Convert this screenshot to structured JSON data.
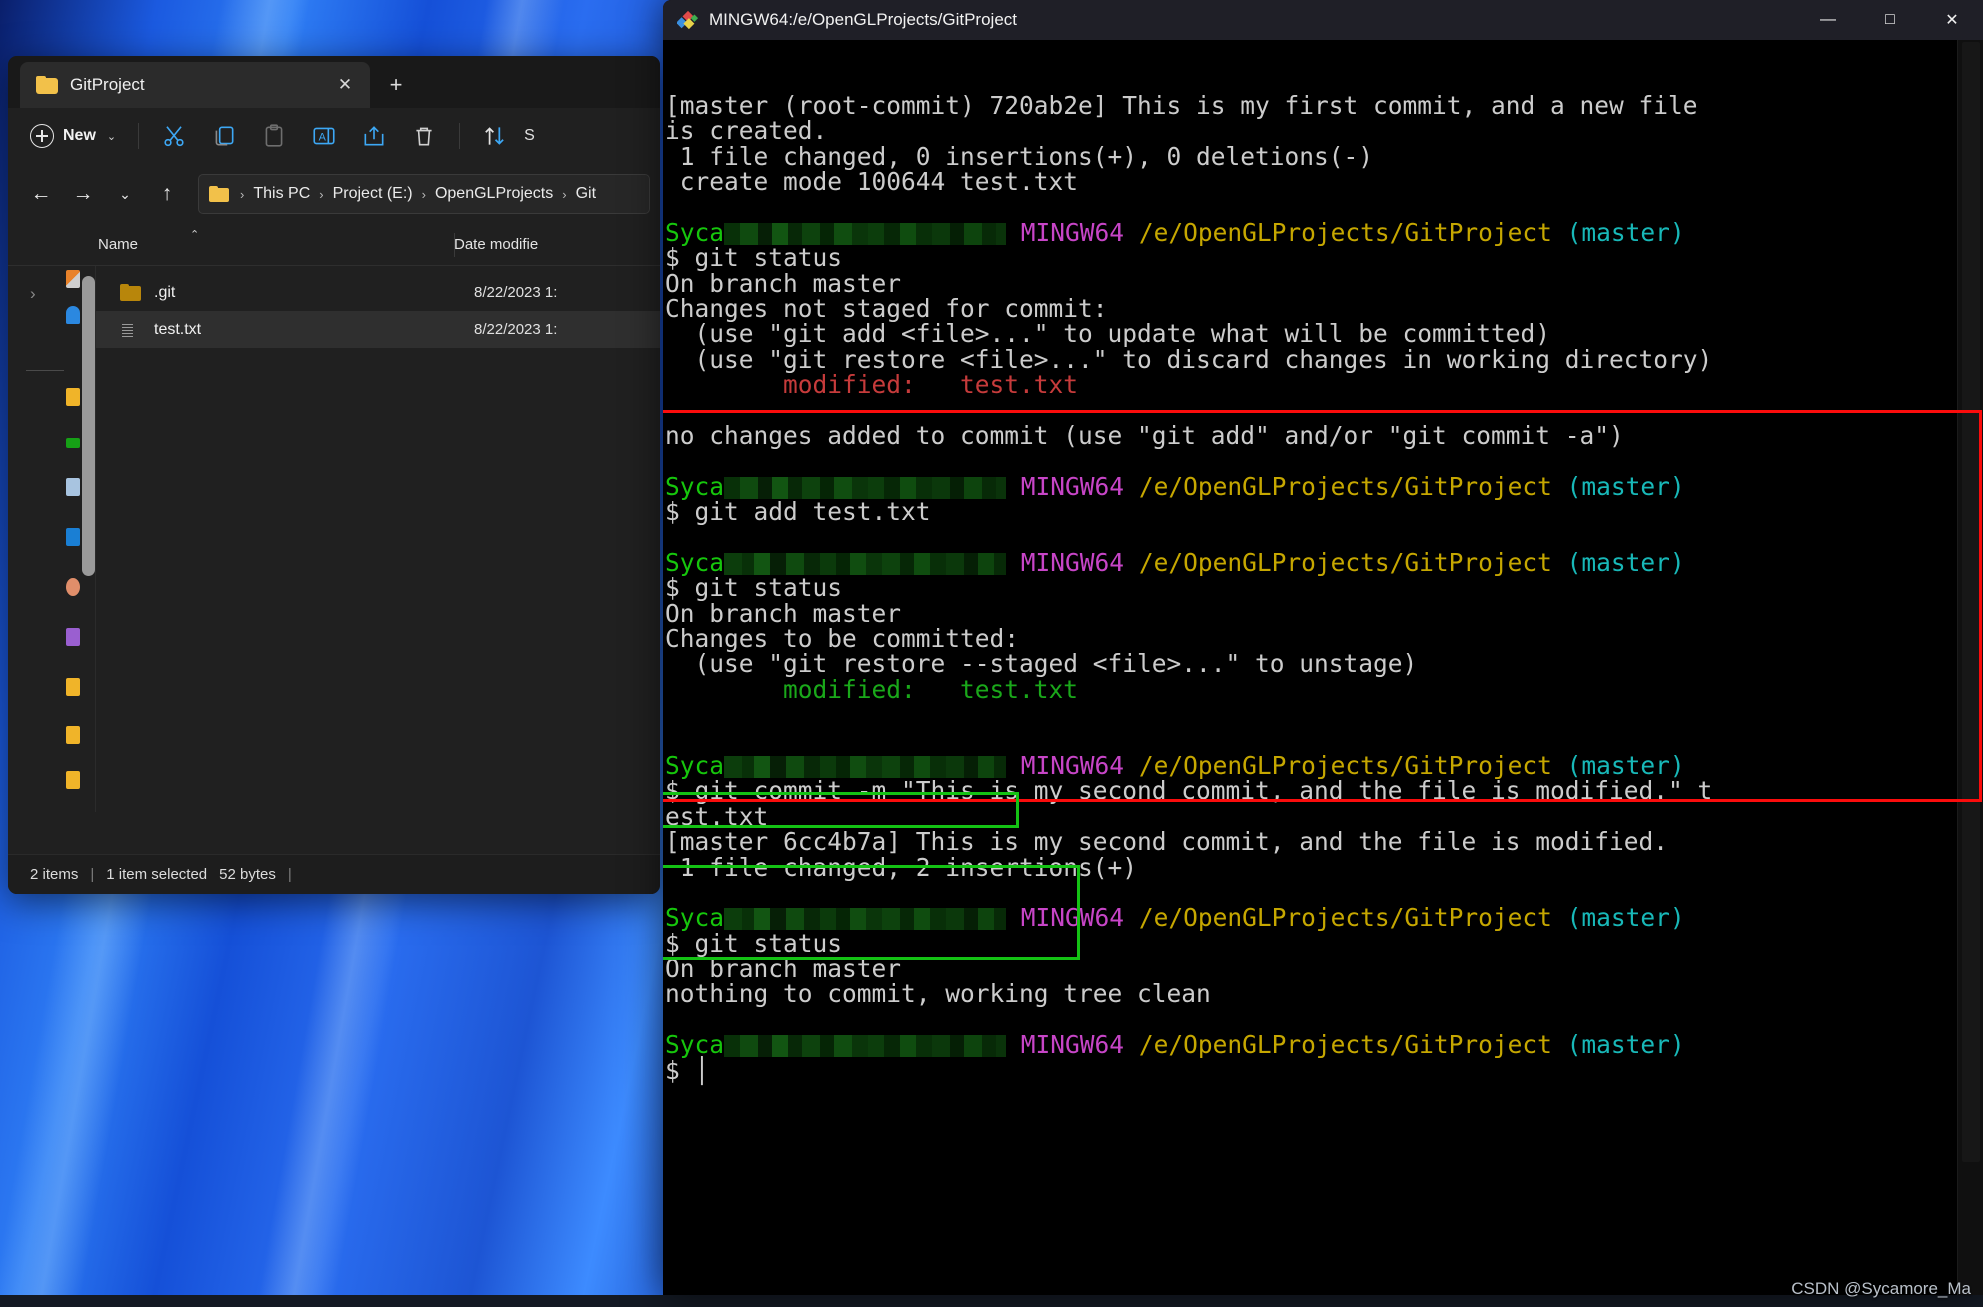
{
  "desktop": {
    "wallpaper": "windows11-blue-bloom"
  },
  "explorer": {
    "tab": {
      "title": "GitProject",
      "close_label": "✕",
      "folder_icon": "folder-icon"
    },
    "new_tab_label": "+",
    "toolbar": {
      "new_label": "New",
      "new_chevron": "⌄",
      "buttons": [
        {
          "name": "cut-button",
          "icon": "scissors-icon"
        },
        {
          "name": "copy-button",
          "icon": "copy-icon"
        },
        {
          "name": "paste-button",
          "icon": "clipboard-icon"
        },
        {
          "name": "rename-button",
          "icon": "rename-icon"
        },
        {
          "name": "share-button",
          "icon": "share-icon"
        },
        {
          "name": "delete-button",
          "icon": "trash-icon"
        },
        {
          "name": "sort-button",
          "icon": "sort-icon"
        }
      ],
      "sort_label": "S"
    },
    "nav": {
      "back": "←",
      "forward": "→",
      "recent": "⌄",
      "up": "↑"
    },
    "breadcrumb": [
      {
        "label": "This PC"
      },
      {
        "label": "Project (E:)"
      },
      {
        "label": "OpenGLProjects"
      },
      {
        "label": "Git"
      }
    ],
    "breadcrumb_separator": "›",
    "columns": {
      "name": "Name",
      "date_modified": "Date modifie",
      "sort_arrow": "⌃"
    },
    "files": [
      {
        "name": ".git",
        "date": "8/22/2023 1:",
        "icon": "folder-icon",
        "selected": false
      },
      {
        "name": "test.txt",
        "date": "8/22/2023 1:",
        "icon": "text-file-icon",
        "selected": true
      }
    ],
    "status": {
      "items": "2 items",
      "selection": "1 item selected",
      "size": "52 bytes",
      "divider": "|"
    }
  },
  "terminal": {
    "title": "MINGW64:/e/OpenGLProjects/GitProject",
    "title_icon": "mingw-diamond-icon",
    "window_buttons": {
      "minimize": "—",
      "maximize": "□",
      "close": "✕"
    },
    "prompt": {
      "user": "Syca",
      "redacted": "redacted-hostname",
      "shell": "MINGW64",
      "path": "/e/OpenGLProjects/GitProject",
      "branch": "(master)",
      "sigil": "$"
    },
    "colors": {
      "user": "#16c60c",
      "shell": "#c745c7",
      "path": "#c6a700",
      "branch": "#18b8b8",
      "text": "#cccccc",
      "error": "#c63b3b",
      "staged": "#1aa81a",
      "background": "#000000"
    },
    "lines": [
      {
        "id": "l1",
        "type": "out",
        "text": "[master (root-commit) 720ab2e] This is my first commit, and a new file"
      },
      {
        "id": "l2",
        "type": "out",
        "text": "is created."
      },
      {
        "id": "l3",
        "type": "out",
        "text": " 1 file changed, 0 insertions(+), 0 deletions(-)"
      },
      {
        "id": "l4",
        "type": "out",
        "text": " create mode 100644 test.txt"
      },
      {
        "id": "l5",
        "type": "blank",
        "text": ""
      },
      {
        "id": "l6",
        "type": "prompt"
      },
      {
        "id": "l7",
        "type": "cmd",
        "text": "$ git status"
      },
      {
        "id": "l8",
        "type": "out",
        "text": "On branch master"
      },
      {
        "id": "l9",
        "type": "out",
        "text": "Changes not staged for commit:"
      },
      {
        "id": "l10",
        "type": "out",
        "text": "  (use \"git add <file>...\" to update what will be committed)"
      },
      {
        "id": "l11",
        "type": "out",
        "text": "  (use \"git restore <file>...\" to discard changes in working directory)"
      },
      {
        "id": "l12",
        "type": "mod-red",
        "text": "        modified:   test.txt"
      },
      {
        "id": "l13",
        "type": "blank",
        "text": ""
      },
      {
        "id": "l14",
        "type": "out",
        "text": "no changes added to commit (use \"git add\" and/or \"git commit -a\")"
      },
      {
        "id": "l15",
        "type": "blank",
        "text": ""
      },
      {
        "id": "l16",
        "type": "prompt"
      },
      {
        "id": "l17",
        "type": "cmd",
        "text": "$ git add test.txt"
      },
      {
        "id": "l18",
        "type": "blank",
        "text": ""
      },
      {
        "id": "l19",
        "type": "prompt"
      },
      {
        "id": "l20",
        "type": "cmd",
        "text": "$ git status"
      },
      {
        "id": "l21",
        "type": "out",
        "text": "On branch master"
      },
      {
        "id": "l22",
        "type": "out",
        "text": "Changes to be committed:"
      },
      {
        "id": "l23",
        "type": "out",
        "text": "  (use \"git restore --staged <file>...\" to unstage)"
      },
      {
        "id": "l24",
        "type": "mod-green",
        "text": "        modified:   test.txt"
      },
      {
        "id": "l25",
        "type": "blank",
        "text": ""
      },
      {
        "id": "l26",
        "type": "blank",
        "text": ""
      },
      {
        "id": "l27",
        "type": "prompt"
      },
      {
        "id": "l28",
        "type": "cmd",
        "text": "$ git commit -m \"This is my second commit, and the file is modified.\" t"
      },
      {
        "id": "l29",
        "type": "cmd",
        "text": "est.txt"
      },
      {
        "id": "l30",
        "type": "out",
        "text": "[master 6cc4b7a] This is my second commit, and the file is modified."
      },
      {
        "id": "l31",
        "type": "out",
        "text": " 1 file changed, 2 insertions(+)"
      },
      {
        "id": "l32",
        "type": "blank",
        "text": ""
      },
      {
        "id": "l33",
        "type": "prompt"
      },
      {
        "id": "l34",
        "type": "cmd",
        "text": "$ git status"
      },
      {
        "id": "l35",
        "type": "out",
        "text": "On branch master"
      },
      {
        "id": "l36",
        "type": "out",
        "text": "nothing to commit, working tree clean"
      },
      {
        "id": "l37",
        "type": "blank",
        "text": ""
      },
      {
        "id": "l38",
        "type": "prompt"
      },
      {
        "id": "l39",
        "type": "cmd",
        "text": "$ "
      }
    ],
    "annotations": [
      {
        "name": "red-highlight-box",
        "color": "#fb0c0c",
        "label": "staging-and-commit-region"
      },
      {
        "name": "green-highlight-box-insertions",
        "color": "#14c214",
        "label": "1 file changed, 2 insertions(+)"
      },
      {
        "name": "green-highlight-box-clean",
        "color": "#14c214",
        "label": "nothing to commit, working tree clean"
      }
    ]
  },
  "watermark": {
    "text": "CSDN @Sycamore_Ma"
  }
}
